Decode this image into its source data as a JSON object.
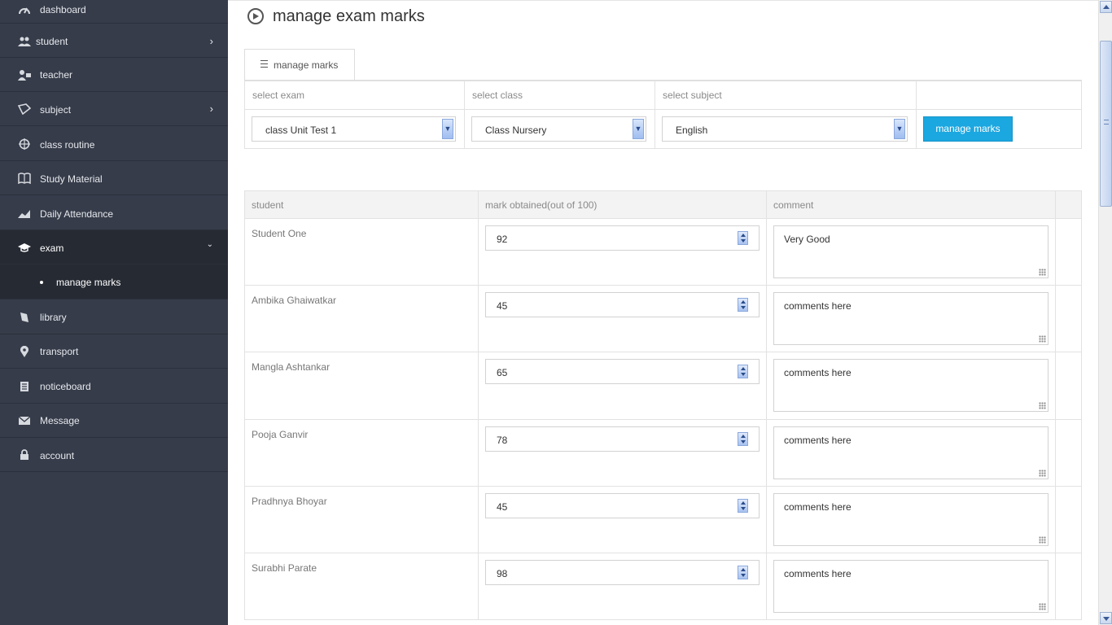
{
  "sidebar": {
    "items": [
      {
        "label": "dashboard",
        "icon": "dashboard-icon"
      },
      {
        "label": "student",
        "icon": "users-icon"
      },
      {
        "label": "teacher",
        "icon": "teacher-icon"
      },
      {
        "label": "subject",
        "icon": "subject-icon"
      },
      {
        "label": "class routine",
        "icon": "routine-icon"
      },
      {
        "label": "Study Material",
        "icon": "book-icon"
      },
      {
        "label": "Daily Attendance",
        "icon": "chart-icon"
      },
      {
        "label": "exam",
        "icon": "graduation-cap-icon"
      },
      {
        "label": "library",
        "icon": "library-icon"
      },
      {
        "label": "transport",
        "icon": "map-marker-icon"
      },
      {
        "label": "noticeboard",
        "icon": "noticeboard-icon"
      },
      {
        "label": "Message",
        "icon": "envelope-icon"
      },
      {
        "label": "account",
        "icon": "lock-icon"
      }
    ],
    "sub_item": "manage marks"
  },
  "page": {
    "title": "manage exam marks",
    "tab_label": "manage marks"
  },
  "filters": {
    "exam_header": "select exam",
    "class_header": "select class",
    "subject_header": "select subject",
    "exam_value": "class Unit Test 1",
    "class_value": "Class Nursery",
    "subject_value": "English",
    "button_label": "manage marks"
  },
  "marks_table": {
    "headers": [
      "student",
      "mark obtained(out of 100)",
      "comment"
    ],
    "rows": [
      {
        "student": "Student One",
        "mark": "92",
        "comment": "Very Good"
      },
      {
        "student": "Ambika Ghaiwatkar",
        "mark": "45",
        "comment": "comments here"
      },
      {
        "student": "Mangla Ashtankar",
        "mark": "65",
        "comment": "comments here"
      },
      {
        "student": "Pooja Ganvir",
        "mark": "78",
        "comment": "comments here"
      },
      {
        "student": "Pradhnya Bhoyar",
        "mark": "45",
        "comment": "comments here"
      },
      {
        "student": "Surabhi Parate",
        "mark": "98",
        "comment": "comments here"
      }
    ]
  },
  "colors": {
    "sidebar_bg": "#363c4a",
    "sidebar_active_bg": "#262a33",
    "primary_button": "#1ba7e0"
  }
}
